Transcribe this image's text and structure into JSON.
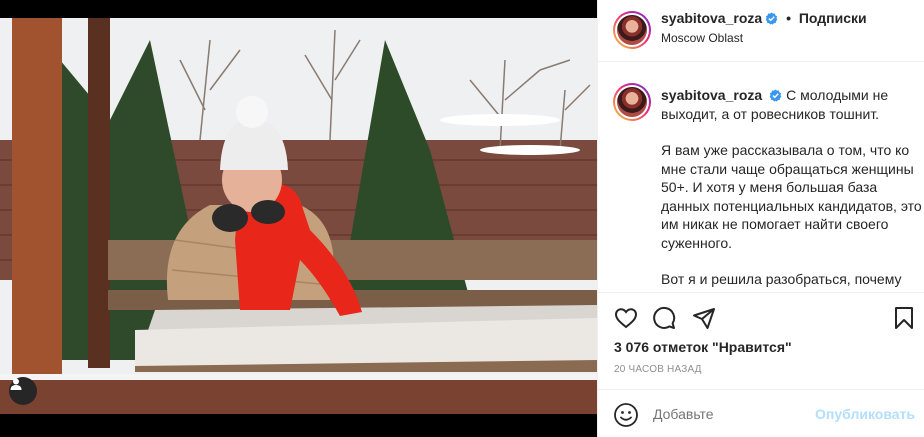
{
  "post": {
    "username": "syabitova_roza",
    "follow_label": "Подписки",
    "separator": "•",
    "location": "Moscow Oblast",
    "caption_paragraphs": [
      "С молодыми не выходит, а от ровесников тошнит.",
      "Я вам уже рассказывала о том, что ко мне стали чаще обращаться женщины 50+. И хотя у меня большая база данных потенциальных кандидатов, это им никак не помогает найти своего суженного.",
      "Вот я и решила разобраться, почему"
    ],
    "likes": "3 076 отметок \"Нравится\"",
    "time_ago": "20 ЧАСОВ НАЗАД"
  },
  "comment": {
    "placeholder": "Добавьте",
    "publish_label": "Опубликовать"
  },
  "icons": {
    "like": "heart-icon",
    "comment": "comment-icon",
    "share": "share-icon",
    "save": "bookmark-icon",
    "emoji": "emoji-icon",
    "tag": "user-tag-icon",
    "verified": "verified-badge-icon"
  },
  "colors": {
    "verified_blue": "#3897f0",
    "muted_text": "#8e8e8e",
    "publish_disabled": "#b2dffc",
    "scarf_red": "#e8261a"
  }
}
